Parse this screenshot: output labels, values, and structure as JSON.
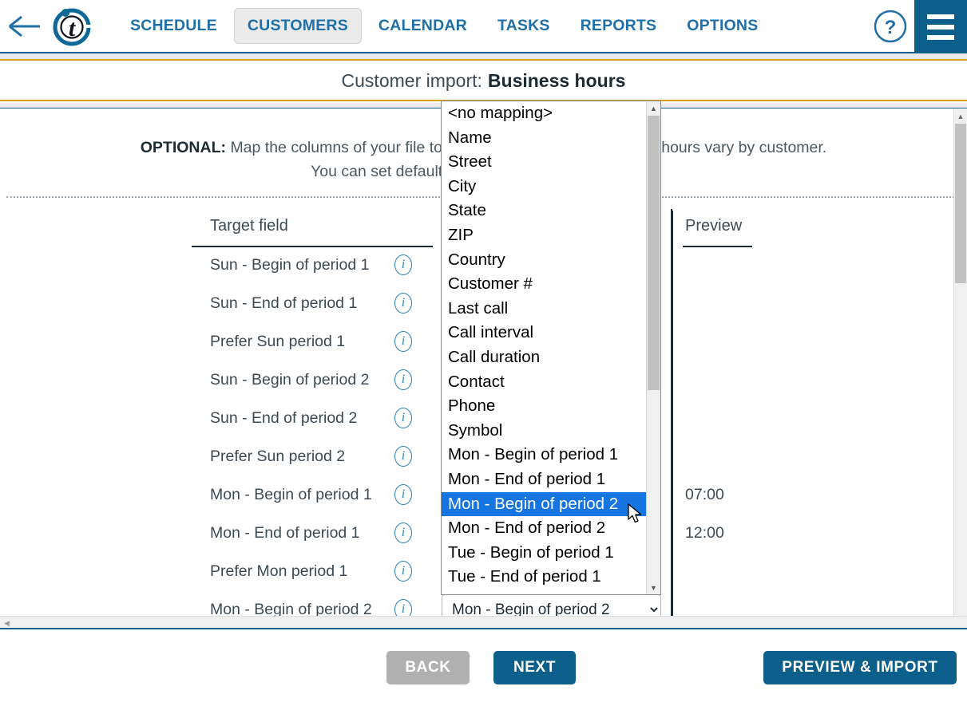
{
  "nav": {
    "back_icon": "arrow-left-icon",
    "logo_icon": "brand-t-logo",
    "items": [
      {
        "label": "SCHEDULE",
        "active": false
      },
      {
        "label": "CUSTOMERS",
        "active": true
      },
      {
        "label": "CALENDAR",
        "active": false
      },
      {
        "label": "TASKS",
        "active": false
      },
      {
        "label": "REPORTS",
        "active": false
      },
      {
        "label": "OPTIONS",
        "active": false
      }
    ],
    "help_icon": "question-mark-icon",
    "menu_icon": "hamburger-menu-icon"
  },
  "page": {
    "title_prefix": "Customer import:",
    "title_main": "Business hours",
    "optional_strong": "OPTIONAL:",
    "optional_line1": "Map the columns of your file to the target fields if the business hours vary by customer.",
    "optional_line2": "You can set default business hours in the settings."
  },
  "table": {
    "header_target": "Target field",
    "header_preview": "Preview",
    "info_icon": "info-icon",
    "info_glyph": "i",
    "rows": [
      {
        "target": "Sun - Begin of period 1",
        "preview": ""
      },
      {
        "target": "Sun - End of period 1",
        "preview": ""
      },
      {
        "target": "Prefer Sun period 1",
        "preview": ""
      },
      {
        "target": "Sun - Begin of period 2",
        "preview": ""
      },
      {
        "target": "Sun - End of period 2",
        "preview": ""
      },
      {
        "target": "Prefer Sun period 2",
        "preview": ""
      },
      {
        "target": "Mon - Begin of period 1",
        "preview": "07:00"
      },
      {
        "target": "Mon - End of period 1",
        "preview": "12:00"
      },
      {
        "target": "Prefer Mon period 1",
        "preview": ""
      },
      {
        "target": "Mon - Begin of period 2",
        "preview": ""
      }
    ]
  },
  "source_select": {
    "value": "Mon - Begin of period 2",
    "chevron_icon": "chevron-down-icon"
  },
  "dropdown": {
    "open": true,
    "selected": "Mon - Begin of period 2",
    "selected_index": 17,
    "cursor_icon": "mouse-pointer-cursor",
    "scroll_up_icon": "triangle-up-icon",
    "scroll_down_icon": "triangle-down-icon",
    "options": [
      "<no mapping>",
      "Name",
      "Street",
      "City",
      "State",
      "ZIP",
      "Country",
      "Customer #",
      "Last call",
      "Call interval",
      "Call duration",
      "Contact",
      "Phone",
      "Symbol",
      "Mon - Begin of period 1",
      "Mon - End of period 1",
      "Mon - Begin of period 2",
      "Mon - End of period 2",
      "Tue - Begin of period 1",
      "Tue - End of period 1"
    ]
  },
  "footer": {
    "back": "BACK",
    "next": "NEXT",
    "import": "PREVIEW & IMPORT"
  },
  "colors": {
    "brand_blue": "#0b5f8a",
    "nav_link": "#1f6fa8",
    "accent_gold": "#d6a017",
    "highlight_blue": "#1675e0",
    "disabled_gray": "#b0b0b0"
  }
}
